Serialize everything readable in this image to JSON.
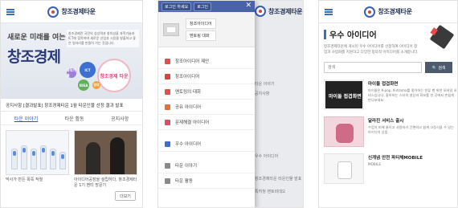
{
  "brand": "창조경제타운",
  "screen1": {
    "hero_line1": "새로운 미래를 여는",
    "hero_line2": "창조경제",
    "hero_desc": "창조경제란 국민의 상상력과 창의성을 과학기술과 ICT에 접목하여 새로운 산업과 시장을 창출하고 좋은 일자리를 만들어 가는 것입니다.",
    "bubbles": [
      "ICT",
      "창조경제 타운",
      "IDEA",
      "과학기술",
      "창의"
    ],
    "notice": "공지사항 [결과발표] 창조경제타운 1월 타운인물 선정 결과 발표",
    "tabs": [
      "타운 이야기",
      "타운 활동",
      "공지사항"
    ],
    "cards": [
      {
        "caption": "막사가 만든 폭죽 작렬"
      },
      {
        "caption": "아이디어공장을 설립하다, 창조경제타운 1기 멘티 방문기"
      }
    ],
    "more": "더보기"
  },
  "screen2": {
    "login": "로그인 하세요",
    "signup": "로그인",
    "close": "✕",
    "profile_links": [
      "창조아이디어",
      "멘토링 대화"
    ],
    "menu": [
      {
        "label": "창조아이디어 제안",
        "color": "#e2504b"
      },
      {
        "label": "창조아이디어",
        "color": "#d6453d"
      },
      {
        "label": "멘토링의 대화",
        "color": "#e2504b"
      },
      {
        "label": "공유 아이디어",
        "color": "#e0713a"
      },
      {
        "label": "문제해결 아이디어",
        "color": "#d94f67"
      }
    ],
    "menu2": [
      {
        "label": "우수 아이디어",
        "color": "#3d6fd1"
      }
    ],
    "menu3": [
      {
        "label": "타운 이야기",
        "color": "#8a8a8a"
      },
      {
        "label": "타운 활동",
        "color": "#8a8a8a"
      }
    ],
    "bg_lines": [
      "타운 이야기",
      "공지사항",
      "우수 아이디어",
      "창조경제타운 타운인물 발표",
      "특허청 멘토비데오"
    ]
  },
  "screen3": {
    "section_title": "우수 아이디어",
    "intro": "창조경제타운에 게시된 우수 아이디어를 선정하여 아이디어 창업과 사업화를 지원하고 다양한 창의적 아이디어를 소개합니다.",
    "search_placeholder": "검색",
    "search_button": "검색",
    "items": [
      {
        "title": "마이돌 접겹화면",
        "desc": "마이돌은 K-pop, K-drama를 좋아하는 한류 팬 위한 모바일 서비스입니다. 좋아하는 스타의 영상과 화보를 한 곳에서 손쉽게 만나보세요.",
        "pic_text": "마이돌 접겹화면"
      },
      {
        "title": "달라진 서비스 출시",
        "desc": "수업의 피해 줄이고 사용자가 간편하고 쉽게 고정식을 수 있는 아이디어 상품.",
        "pic_text": ""
      },
      {
        "title": "신개념 안전 파티체MOBILE",
        "desc": "MOBILE",
        "pic_text": ""
      }
    ]
  }
}
